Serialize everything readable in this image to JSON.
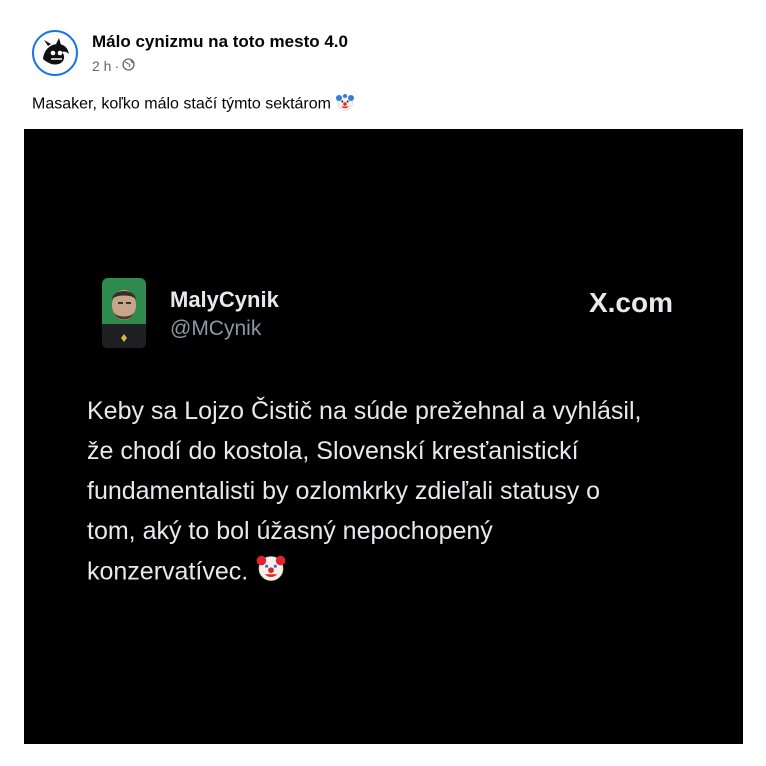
{
  "post": {
    "page_name": "Málo cynizmu na toto mesto 4.0",
    "time": "2 h",
    "separator": "·",
    "audience_icon": "globe-icon",
    "caption_text": "Masaker, koľko málo stačí týmto sektárom",
    "caption_emoji": "clown-face-icon"
  },
  "tweet": {
    "display_name": "MalyCynik",
    "handle": "@MCynik",
    "brand": "X.com",
    "lines": [
      "Keby sa Lojzo Čistič na súde prežehnal a vyhlásil,",
      "že chodí do kostola, Slovenskí kresťanistickí",
      "fundamentalisti by ozlomkrky zdieľali statusy o",
      "tom, aký to bol úžasný nepochopený",
      "konzervatívec."
    ],
    "end_emoji": "clown-face-icon"
  },
  "colors": {
    "link_blue": "#1b74e4",
    "meta_gray": "#65676b",
    "tweet_bg": "#000000",
    "tweet_text": "#e7e9ea",
    "tweet_handle": "#8b98a5"
  }
}
